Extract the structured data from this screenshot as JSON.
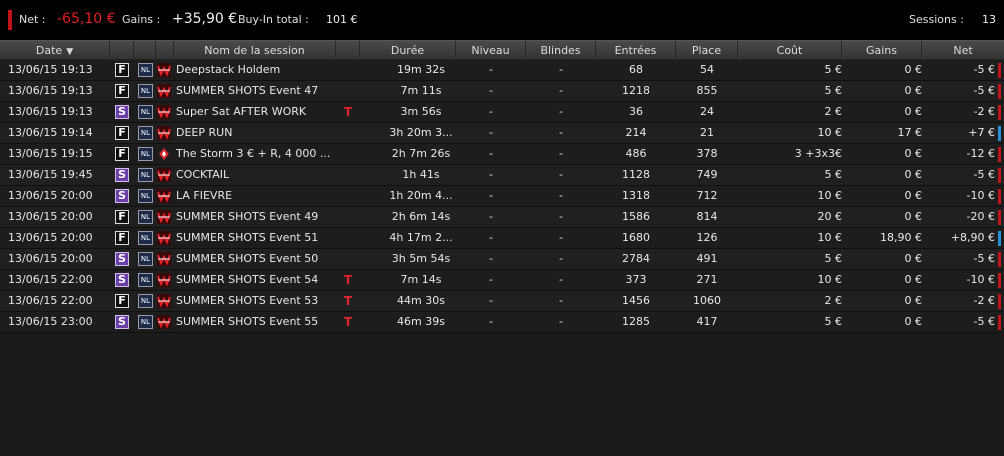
{
  "summary": {
    "net_label": "Net :",
    "net_value": "-65,10 €",
    "gains_label": "Gains :",
    "gains_value": "+35,90 €",
    "buyin_label": "Buy-In total :",
    "buyin_value": "101 €",
    "sessions_label": "Sessions :",
    "sessions_value": "13"
  },
  "colors": {
    "negative": "#c0141b",
    "positive": "#2a8fd6",
    "special_type": "#6b3fa5"
  },
  "columns": {
    "date": "Date",
    "name": "Nom de la session",
    "duration": "Durée",
    "level": "Niveau",
    "blinds": "Blindes",
    "entries": "Entrées",
    "place": "Place",
    "cost": "Coût",
    "gains": "Gains",
    "net": "Net",
    "sort_icon": "triangle-down-icon"
  },
  "rows": [
    {
      "date": "13/06/15 19:13",
      "type": "F",
      "game": "NL",
      "room_icon": "room-logo-icon",
      "name": "Deepstack Holdem",
      "t": "",
      "duration": "19m 32s",
      "level": "-",
      "blinds": "-",
      "entries": "68",
      "place": "54",
      "cost": "5 €",
      "gains": "0 €",
      "net": "-5 €",
      "sign": "neg"
    },
    {
      "date": "13/06/15 19:13",
      "type": "F",
      "game": "NL",
      "room_icon": "room-logo-icon",
      "name": "SUMMER SHOTS Event 47",
      "t": "",
      "duration": "7m 11s",
      "level": "-",
      "blinds": "-",
      "entries": "1218",
      "place": "855",
      "cost": "5 €",
      "gains": "0 €",
      "net": "-5 €",
      "sign": "neg"
    },
    {
      "date": "13/06/15 19:13",
      "type": "S",
      "game": "NL",
      "room_icon": "room-logo-icon",
      "name": "Super Sat AFTER WORK",
      "t": "T",
      "duration": "3m 56s",
      "level": "-",
      "blinds": "-",
      "entries": "36",
      "place": "24",
      "cost": "2 €",
      "gains": "0 €",
      "net": "-2 €",
      "sign": "neg"
    },
    {
      "date": "13/06/15 19:14",
      "type": "F",
      "game": "NL",
      "room_icon": "room-logo-icon",
      "name": "DEEP RUN",
      "t": "",
      "duration": "3h 20m 3...",
      "level": "-",
      "blinds": "-",
      "entries": "214",
      "place": "21",
      "cost": "10 €",
      "gains": "17 €",
      "net": "+7 €",
      "sign": "pos"
    },
    {
      "date": "13/06/15 19:15",
      "type": "F",
      "game": "NL",
      "room_icon": "pokerstars-logo-icon",
      "name": "The Storm 3 € + R, 4 000 ...",
      "t": "",
      "duration": "2h 7m 26s",
      "level": "-",
      "blinds": "-",
      "entries": "486",
      "place": "378",
      "cost": "3  +3x3€",
      "gains": "0 €",
      "net": "-12 €",
      "sign": "neg"
    },
    {
      "date": "13/06/15 19:45",
      "type": "S",
      "game": "NL",
      "room_icon": "room-logo-icon",
      "name": "COCKTAIL",
      "t": "",
      "duration": "1h 41s",
      "level": "-",
      "blinds": "-",
      "entries": "1128",
      "place": "749",
      "cost": "5 €",
      "gains": "0 €",
      "net": "-5 €",
      "sign": "neg"
    },
    {
      "date": "13/06/15 20:00",
      "type": "S",
      "game": "NL",
      "room_icon": "room-logo-icon",
      "name": "LA FIEVRE",
      "t": "",
      "duration": "1h 20m 4...",
      "level": "-",
      "blinds": "-",
      "entries": "1318",
      "place": "712",
      "cost": "10 €",
      "gains": "0 €",
      "net": "-10 €",
      "sign": "neg"
    },
    {
      "date": "13/06/15 20:00",
      "type": "F",
      "game": "NL",
      "room_icon": "room-logo-icon",
      "name": "SUMMER SHOTS Event 49",
      "t": "",
      "duration": "2h 6m 14s",
      "level": "-",
      "blinds": "-",
      "entries": "1586",
      "place": "814",
      "cost": "20 €",
      "gains": "0 €",
      "net": "-20 €",
      "sign": "neg"
    },
    {
      "date": "13/06/15 20:00",
      "type": "F",
      "game": "NL",
      "room_icon": "room-logo-icon",
      "name": "SUMMER SHOTS Event 51",
      "t": "",
      "duration": "4h 17m 2...",
      "level": "-",
      "blinds": "-",
      "entries": "1680",
      "place": "126",
      "cost": "10 €",
      "gains": "18,90 €",
      "net": "+8,90 €",
      "sign": "pos"
    },
    {
      "date": "13/06/15 20:00",
      "type": "S",
      "game": "NL",
      "room_icon": "room-logo-icon",
      "name": "SUMMER SHOTS Event 50",
      "t": "",
      "duration": "3h 5m 54s",
      "level": "-",
      "blinds": "-",
      "entries": "2784",
      "place": "491",
      "cost": "5 €",
      "gains": "0 €",
      "net": "-5 €",
      "sign": "neg"
    },
    {
      "date": "13/06/15 22:00",
      "type": "S",
      "game": "NL",
      "room_icon": "room-logo-icon",
      "name": "SUMMER SHOTS Event 54",
      "t": "T",
      "duration": "7m 14s",
      "level": "-",
      "blinds": "-",
      "entries": "373",
      "place": "271",
      "cost": "10 €",
      "gains": "0 €",
      "net": "-10 €",
      "sign": "neg"
    },
    {
      "date": "13/06/15 22:00",
      "type": "F",
      "game": "NL",
      "room_icon": "room-logo-icon",
      "name": "SUMMER SHOTS Event 53",
      "t": "T",
      "duration": "44m 30s",
      "level": "-",
      "blinds": "-",
      "entries": "1456",
      "place": "1060",
      "cost": "2 €",
      "gains": "0 €",
      "net": "-2 €",
      "sign": "neg"
    },
    {
      "date": "13/06/15 23:00",
      "type": "S",
      "game": "NL",
      "room_icon": "room-logo-icon",
      "name": "SUMMER SHOTS Event 55",
      "t": "T",
      "duration": "46m 39s",
      "level": "-",
      "blinds": "-",
      "entries": "1285",
      "place": "417",
      "cost": "5 €",
      "gains": "0 €",
      "net": "-5 €",
      "sign": "neg"
    }
  ]
}
